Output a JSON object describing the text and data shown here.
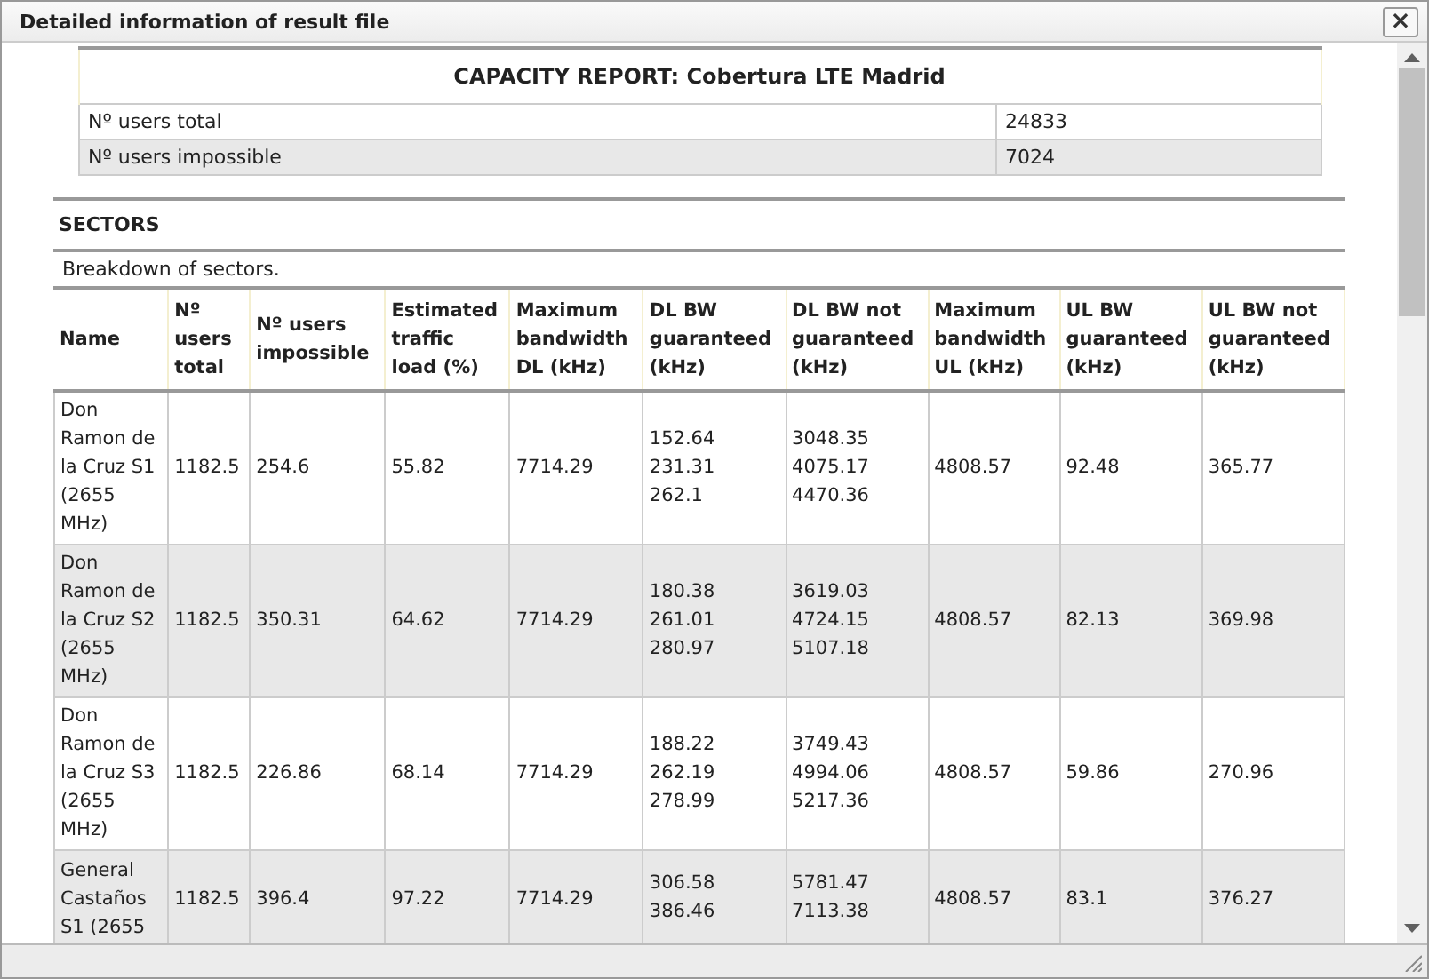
{
  "window": {
    "title": "Detailed information of result file",
    "close_label": "×"
  },
  "capacity_report": {
    "title": "CAPACITY REPORT: Cobertura LTE Madrid",
    "rows": [
      {
        "label": "Nº users total",
        "value": "24833"
      },
      {
        "label": "Nº users impossible",
        "value": "7024"
      }
    ]
  },
  "sectors": {
    "title": "SECTORS",
    "description": "Breakdown of sectors.",
    "columns": [
      "Name",
      "Nº users total",
      "Nº users impossible",
      "Estimated traffic load (%)",
      "Maximum bandwidth DL (kHz)",
      "DL BW guaranteed (kHz)",
      "DL BW not guaranteed (kHz)",
      "Maximum bandwidth UL (kHz)",
      "UL BW guaranteed (kHz)",
      "UL BW not guaranteed (kHz)"
    ],
    "rows": [
      {
        "cells": [
          "Don Ramon de la Cruz S1 (2655 MHz)",
          "1182.5",
          "254.6",
          "55.82",
          "7714.29",
          [
            "152.64",
            "231.31",
            "262.1"
          ],
          [
            "3048.35",
            "4075.17",
            "4470.36"
          ],
          "4808.57",
          "92.48",
          "365.77"
        ]
      },
      {
        "cells": [
          "Don Ramon de la Cruz S2 (2655 MHz)",
          "1182.5",
          "350.31",
          "64.62",
          "7714.29",
          [
            "180.38",
            "261.01",
            "280.97"
          ],
          [
            "3619.03",
            "4724.15",
            "5107.18"
          ],
          "4808.57",
          "82.13",
          "369.98"
        ]
      },
      {
        "cells": [
          "Don Ramon de la Cruz S3 (2655 MHz)",
          "1182.5",
          "226.86",
          "68.14",
          "7714.29",
          [
            "188.22",
            "262.19",
            "278.99"
          ],
          [
            "3749.43",
            "4994.06",
            "5217.36"
          ],
          "4808.57",
          "59.86",
          "270.96"
        ]
      },
      {
        "cells": [
          "General Castaños S1 (2655",
          "1182.5",
          "396.4",
          "97.22",
          "7714.29",
          [
            "306.58",
            "386.46"
          ],
          [
            "5781.47",
            "7113.38"
          ],
          "4808.57",
          "83.1",
          "376.27"
        ]
      }
    ]
  }
}
